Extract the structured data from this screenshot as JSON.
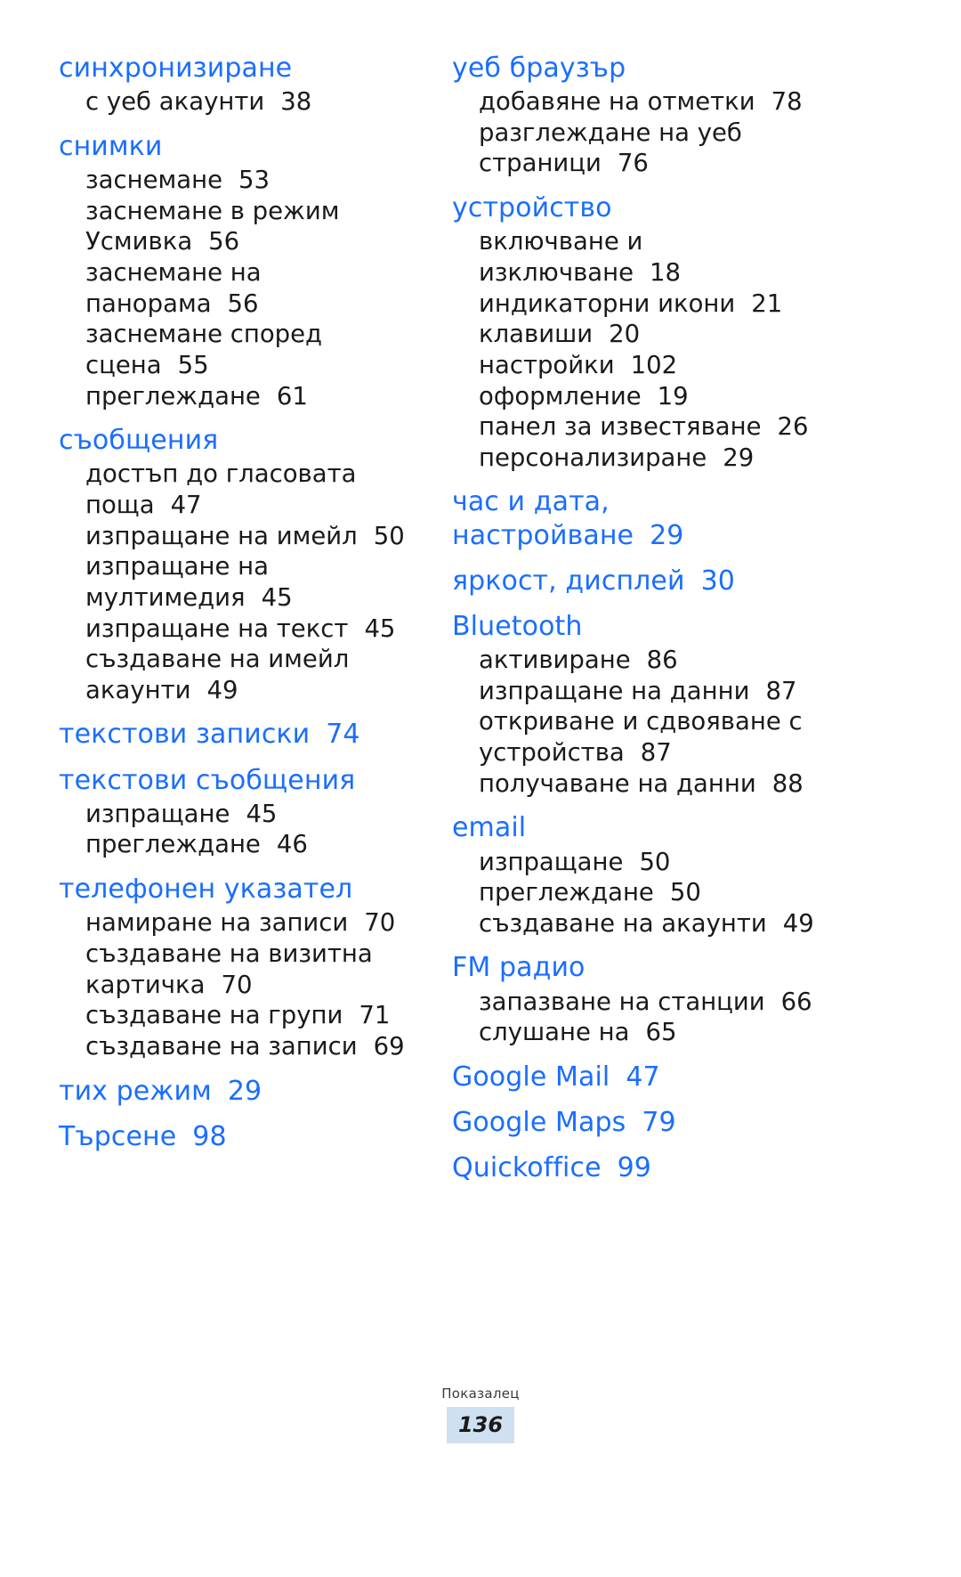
{
  "document": {
    "footer_label": "Показалец",
    "page_number": "136",
    "accent_color": "#1a6eff",
    "badge_color": "#cfe0f0"
  },
  "left_column": [
    {
      "heading": "синхронизиране",
      "heading_page": "",
      "subentries": [
        {
          "label": "с уеб акаунти",
          "page": "38"
        }
      ]
    },
    {
      "heading": "снимки",
      "heading_page": "",
      "subentries": [
        {
          "label": "заснемане",
          "page": "53"
        },
        {
          "label": "заснемане в режим\nУсмивка",
          "page": "56"
        },
        {
          "label": "заснемане на\nпанорама",
          "page": "56"
        },
        {
          "label": "заснемане според\nсцена",
          "page": "55"
        },
        {
          "label": "преглеждане",
          "page": "61"
        }
      ]
    },
    {
      "heading": "съобщения",
      "heading_page": "",
      "subentries": [
        {
          "label": "достъп до гласовата\nпоща",
          "page": "47"
        },
        {
          "label": "изпращане на имейл",
          "page": "50"
        },
        {
          "label": "изпращане на\nмултимедия",
          "page": "45"
        },
        {
          "label": "изпращане на текст",
          "page": "45"
        },
        {
          "label": "създаване на имейл\nакаунти",
          "page": "49"
        }
      ]
    },
    {
      "heading": "текстови записки",
      "heading_page": "74",
      "subentries": []
    },
    {
      "heading": "текстови съобщения",
      "heading_page": "",
      "subentries": [
        {
          "label": "изпращане",
          "page": "45"
        },
        {
          "label": "преглеждане",
          "page": "46"
        }
      ]
    },
    {
      "heading": "телефонен указател",
      "heading_page": "",
      "subentries": [
        {
          "label": "намиране на записи",
          "page": "70"
        },
        {
          "label": "създаване на визитна\nкартичка",
          "page": "70"
        },
        {
          "label": "създаване на групи",
          "page": "71"
        },
        {
          "label": "създаване на записи",
          "page": "69"
        }
      ]
    },
    {
      "heading": "тих режим",
      "heading_page": "29",
      "subentries": []
    },
    {
      "heading": "Търсене",
      "heading_page": "98",
      "subentries": []
    }
  ],
  "right_column": [
    {
      "heading": "уеб браузър",
      "heading_page": "",
      "subentries": [
        {
          "label": "добавяне на отметки",
          "page": "78"
        },
        {
          "label": "разглеждане на уеб\nстраници",
          "page": "76"
        }
      ]
    },
    {
      "heading": "устройство",
      "heading_page": "",
      "subentries": [
        {
          "label": "включване и\nизключване",
          "page": "18"
        },
        {
          "label": "индикаторни икони",
          "page": "21"
        },
        {
          "label": "клавиши",
          "page": "20"
        },
        {
          "label": "настройки",
          "page": "102"
        },
        {
          "label": "оформление",
          "page": "19"
        },
        {
          "label": "панел за известяване",
          "page": "26"
        },
        {
          "label": "персонализиране",
          "page": "29"
        }
      ]
    },
    {
      "heading": "час и дата,\nнастройване",
      "heading_page": "29",
      "subentries": []
    },
    {
      "heading": "яркост, дисплей",
      "heading_page": "30",
      "subentries": []
    },
    {
      "heading": "Bluetooth",
      "heading_page": "",
      "subentries": [
        {
          "label": "активиране",
          "page": "86"
        },
        {
          "label": "изпращане на данни",
          "page": "87"
        },
        {
          "label": "откриване и сдвояване с\nустройства",
          "page": "87"
        },
        {
          "label": "получаване на данни",
          "page": "88"
        }
      ]
    },
    {
      "heading": "email",
      "heading_page": "",
      "subentries": [
        {
          "label": "изпращане",
          "page": "50"
        },
        {
          "label": "преглеждане",
          "page": "50"
        },
        {
          "label": "създаване на акаунти",
          "page": "49"
        }
      ]
    },
    {
      "heading": "FM радио",
      "heading_page": "",
      "subentries": [
        {
          "label": "запазване на станции",
          "page": "66"
        },
        {
          "label": "слушане на",
          "page": "65"
        }
      ]
    },
    {
      "heading": "Google Mail",
      "heading_page": "47",
      "subentries": []
    },
    {
      "heading": "Google Maps",
      "heading_page": "79",
      "subentries": []
    },
    {
      "heading": "Quickoffice",
      "heading_page": "99",
      "subentries": []
    }
  ]
}
